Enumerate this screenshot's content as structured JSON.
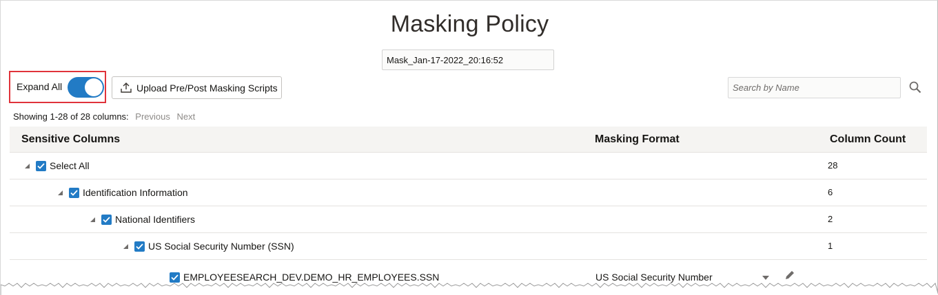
{
  "page": {
    "title": "Masking Policy",
    "policy_name": "Mask_Jan-17-2022_20:16:52"
  },
  "toolbar": {
    "expand_all_label": "Expand All",
    "expand_all_on": true,
    "upload_label": "Upload Pre/Post Masking Scripts",
    "search_placeholder": "Search by Name"
  },
  "paging": {
    "summary": "Showing 1-28 of 28 columns:",
    "previous": "Previous",
    "next": "Next"
  },
  "table": {
    "headers": {
      "sensitive_columns": "Sensitive Columns",
      "masking_format": "Masking Format",
      "column_count": "Column Count"
    },
    "rows": [
      {
        "label": "Select All",
        "count": "28",
        "format": ""
      },
      {
        "label": "Identification Information",
        "count": "6",
        "format": ""
      },
      {
        "label": "National Identifiers",
        "count": "2",
        "format": ""
      },
      {
        "label": "US Social Security Number (SSN)",
        "count": "1",
        "format": ""
      },
      {
        "label": "EMPLOYEESEARCH_DEV.DEMO_HR_EMPLOYEES.SSN",
        "count": "",
        "format": "US Social Security Number"
      }
    ]
  },
  "colors": {
    "accent": "#227bc5",
    "highlight_border": "#e0323a"
  }
}
